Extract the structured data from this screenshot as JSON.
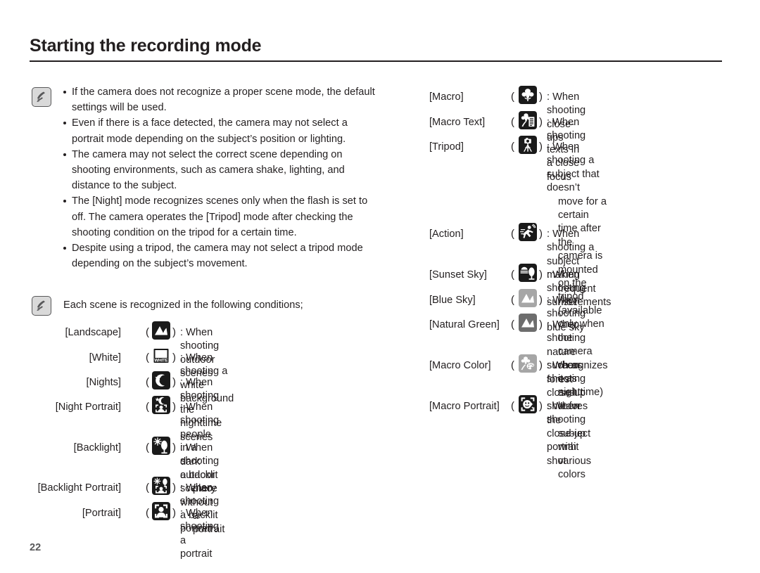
{
  "header": {
    "title": "Starting the recording mode"
  },
  "notes": {
    "icon_name": "samsung-note-icon",
    "bullets": [
      "If the camera does not recognize a proper scene mode, the default settings will be used.",
      "Even if there is a face detected, the camera may not select a portrait mode depending on the subject’s position or lighting.",
      "The camera may not select the correct scene depending on shooting environments, such as camera shake, lighting, and distance to the subject.",
      "The [Night] mode recognizes scenes only when the flash is set to off. The camera operates the [Tripod] mode after checking the shooting condition on the tripod for a certain time.",
      "Despite using a tripod, the camera may not select a tripod mode depending on the subject’s movement."
    ],
    "conditions_intro": "Each scene is recognized in the following conditions;"
  },
  "paren_open": "(",
  "paren_close": ")",
  "separator": ":",
  "scenes_left": [
    {
      "label": "[Landscape]",
      "icon": "landscape-icon",
      "desc_line1": "When shooting outdoor scenes",
      "desc_line2": ""
    },
    {
      "label": "[White]",
      "icon": "white-balance-icon",
      "desc_line1": "When shooting a white background",
      "desc_line2": ""
    },
    {
      "label": "[Nights]",
      "icon": "night-icon",
      "desc_line1": "When shooting the nighttime scenes",
      "desc_line2": ""
    },
    {
      "label": "[Night Portrait]",
      "icon": "night-portrait-icon",
      "desc_line1": "When shooting people in a dark outdoor",
      "desc_line2": "place"
    },
    {
      "label": "[Backlight]",
      "icon": "backlight-icon",
      "desc_line1": "When shooting a backlit scenery without",
      "desc_line2": "a portrait"
    },
    {
      "label": "[Backlight Portrait]",
      "icon": "backlight-portrait-icon",
      "desc_line1": "When shooting a backlit portrait",
      "desc_line2": ""
    },
    {
      "label": "[Portrait]",
      "icon": "portrait-icon",
      "desc_line1": "When shooting a portrait",
      "desc_line2": ""
    }
  ],
  "scenes_right": [
    {
      "label": "[Macro]",
      "icon": "macro-icon",
      "desc_line1": "When shooting close-ups",
      "desc_line2": "",
      "desc_line3": "",
      "desc_line4": "",
      "desc_line5": ""
    },
    {
      "label": "[Macro Text]",
      "icon": "macro-text-icon",
      "desc_line1": "When shooting texts in a close focus",
      "desc_line2": "",
      "desc_line3": "",
      "desc_line4": "",
      "desc_line5": ""
    },
    {
      "label": "[Tripod]",
      "icon": "tripod-icon",
      "desc_line1": "When shooting a subject that doesn’t",
      "desc_line2": "move for a certain time after the",
      "desc_line3": "camera is mounted on the tripod",
      "desc_line4": "(available only when the camera",
      "desc_line5": "recognizes it as nighttime)"
    },
    {
      "label": "[Action]",
      "icon": "action-icon",
      "desc_line1": "When shooting a subject making",
      "desc_line2": "frequent movements",
      "desc_line3": "",
      "desc_line4": "",
      "desc_line5": ""
    },
    {
      "label": "[Sunset Sky]",
      "icon": "sunset-sky-icon",
      "desc_line1": "When shooting sunset",
      "desc_line2": "",
      "desc_line3": "",
      "desc_line4": "",
      "desc_line5": ""
    },
    {
      "label": "[Blue Sky]",
      "icon": "blue-sky-icon",
      "desc_line1": "When shooting blue sky",
      "desc_line2": "",
      "desc_line3": "",
      "desc_line4": "",
      "desc_line5": ""
    },
    {
      "label": "[Natural Green]",
      "icon": "natural-green-icon",
      "desc_line1": "When shooting nature such as forest",
      "desc_line2": "and leaves",
      "desc_line3": "",
      "desc_line4": "",
      "desc_line5": ""
    },
    {
      "label": "[Macro Color]",
      "icon": "macro-color-icon",
      "desc_line1": "When shooting close-up shot for the",
      "desc_line2": "subject with various colors",
      "desc_line3": "",
      "desc_line4": "",
      "desc_line5": ""
    },
    {
      "label": "[Macro Portrait]",
      "icon": "macro-portrait-icon",
      "desc_line1": "When shooting close-up portrait shot",
      "desc_line2": "",
      "desc_line3": "",
      "desc_line4": "",
      "desc_line5": ""
    }
  ],
  "footer": {
    "page_number": "22"
  },
  "colors": {
    "text": "#231f20",
    "icon_dark": "#1a1a1a",
    "icon_gray_light": "#a6a6a6",
    "icon_gray_dark": "#6d6d6d",
    "note_chip_fill": "#d9d9d9",
    "note_chip_border": "#58585a",
    "page_number": "#58585a"
  }
}
